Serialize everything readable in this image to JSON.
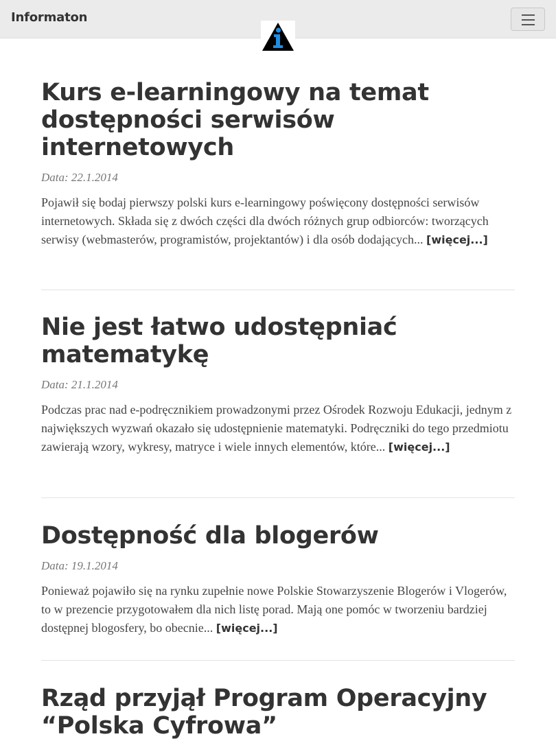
{
  "navbar": {
    "brand": "Informaton",
    "logo_icon": "info-logo-icon",
    "menu_icon": "hamburger-menu-icon"
  },
  "posts": [
    {
      "title": "Kurs e-learningowy na temat dostępności serwisów internetowych",
      "date": "Data: 22.1.2014",
      "excerpt": "Pojawił się bodaj pierwszy polski kurs e-learningowy poświęcony dostępności serwisów internetowych. Składa się z dwóch części dla dwóch różnych grup odbiorców: tworzących serwisy (webmasterów, programistów, projektantów) i dla osób dodających...",
      "more": "[więcej...]"
    },
    {
      "title": "Nie jest łatwo udostępniać matematykę",
      "date": "Data: 21.1.2014",
      "excerpt": "Podczas prac nad e-podręcznikiem prowadzonymi przez Ośrodek Rozwoju Edukacji, jednym z największych wyzwań okazało się udostępnienie matematyki. Podręczniki do tego przedmiotu zawierają wzory, wykresy, matryce i wiele innych elementów, które...",
      "more": "[więcej...]"
    },
    {
      "title": "Dostępność dla blogerów",
      "date": "Data: 19.1.2014",
      "excerpt": "Ponieważ pojawiło się na rynku zupełnie nowe Polskie Stowarzyszenie Blogerów i Vlogerów, to w prezencie przygotowałem dla nich listę porad. Mają one pomóc w tworzeniu bardziej dostępnej blogosfery, bo obecnie...",
      "more": "[więcej...]"
    },
    {
      "title": "Rząd przyjął Program Operacyjny “Polska Cyfrowa”"
    }
  ]
}
